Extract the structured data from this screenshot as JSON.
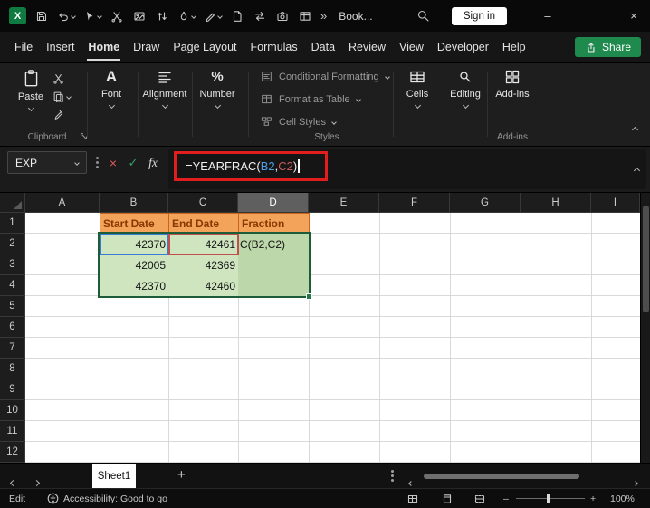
{
  "icons": {
    "logo_glyph": "X",
    "overflow": "»",
    "minimize": "–",
    "close": "×",
    "cancel": "×",
    "enter": "✓",
    "fx": "fx",
    "add_sheet": "+",
    "zoom_out": "–",
    "zoom_in": "+",
    "font_glyph": "A",
    "percent_glyph": "%"
  },
  "titlebar": {
    "app_title": "Book...",
    "signin_label": "Sign in"
  },
  "menubar": {
    "items": [
      "File",
      "Insert",
      "Home",
      "Draw",
      "Page Layout",
      "Formulas",
      "Data",
      "Review",
      "View",
      "Developer",
      "Help"
    ],
    "active_item": "Home",
    "share_label": "Share"
  },
  "ribbon": {
    "paste_label": "Paste",
    "font_label": "Font",
    "alignment_label": "Alignment",
    "number_label": "Number",
    "styles_items": [
      "Conditional Formatting",
      "Format as Table",
      "Cell Styles"
    ],
    "cells_label": "Cells",
    "editing_label": "Editing",
    "addins_label": "Add-ins",
    "group_labels": {
      "clipboard": "Clipboard",
      "styles": "Styles",
      "addins": "Add-ins"
    }
  },
  "formula_bar": {
    "name_box_value": "EXP",
    "formula": {
      "prefix": "=YEARFRAC(",
      "ref1": "B2",
      "separator": ",",
      "ref2": "C2",
      "suffix": ")"
    }
  },
  "grid": {
    "col_headers": [
      "A",
      "B",
      "C",
      "D",
      "E",
      "F",
      "G",
      "H",
      "I"
    ],
    "row_headers": [
      "1",
      "2",
      "3",
      "4",
      "5",
      "6",
      "7",
      "8",
      "9",
      "10",
      "11",
      "12"
    ],
    "cells": {
      "b1": "Start Date",
      "c1": "End Date",
      "d1": "Fraction",
      "b2": "42370",
      "c2": "42461",
      "d2": "C(B2,C2)",
      "b3": "42005",
      "c3": "42369",
      "b4": "42370",
      "c4": "42460"
    }
  },
  "sheetbar": {
    "active_tab": "Sheet1"
  },
  "statusbar": {
    "mode": "Edit",
    "accessibility_text": "Accessibility: Good to go",
    "zoom_level": "100%"
  },
  "colors": {
    "accent_green": "#217346",
    "share_green": "#1e8a4d",
    "header_orange_fill": "#f3a35a",
    "header_orange_text": "#8a3800",
    "range_green_fill": "#cfe5c0",
    "fraction_green_fill": "#bcd8aa",
    "ref_blue": "#3a7bd5",
    "ref_red": "#c0504d",
    "annotation_red": "#e11d1d"
  }
}
